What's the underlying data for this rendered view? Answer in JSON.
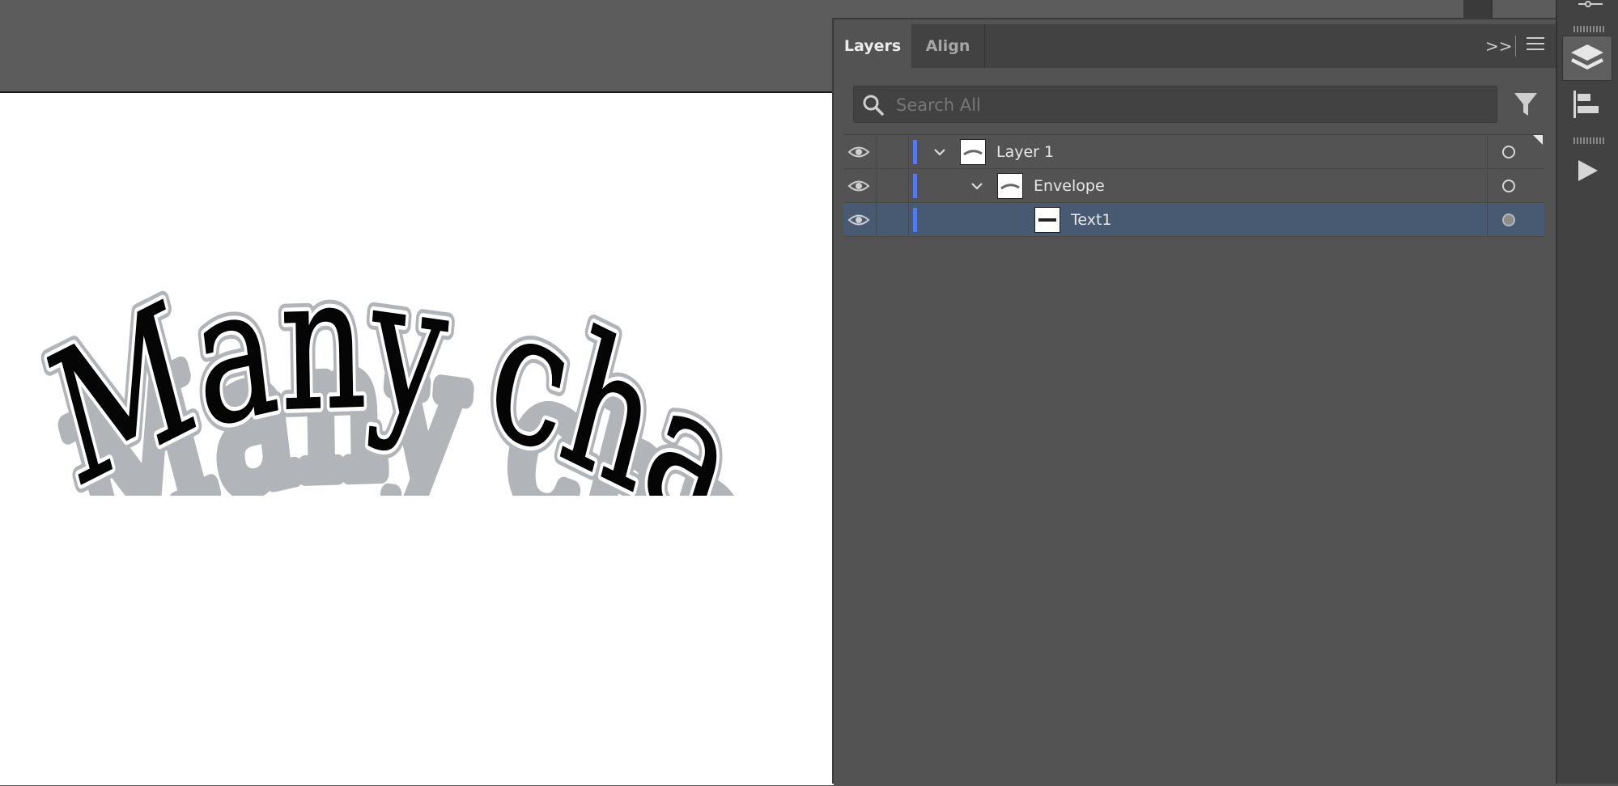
{
  "panel": {
    "tabs": [
      {
        "label": "Layers",
        "active": true
      },
      {
        "label": "Align",
        "active": false
      }
    ],
    "collapse_icon": ">>",
    "search": {
      "placeholder": "Search All",
      "value": ""
    }
  },
  "layers": [
    {
      "name": "Layer 1",
      "expanded": true,
      "depth": 0,
      "visible": true,
      "selected": false,
      "target": "empty"
    },
    {
      "name": "Envelope",
      "expanded": true,
      "depth": 1,
      "visible": true,
      "selected": false,
      "target": "empty"
    },
    {
      "name": "Text1",
      "expanded": null,
      "depth": 2,
      "visible": true,
      "selected": true,
      "target": "filled"
    }
  ],
  "artwork": {
    "text": "Many charact"
  },
  "dock": {
    "buttons": [
      "layers-icon",
      "align-icon",
      "play-icon"
    ]
  },
  "colors": {
    "layer_color": "#4f7aff",
    "selection": "#485a72",
    "panel_bg": "#535353"
  }
}
